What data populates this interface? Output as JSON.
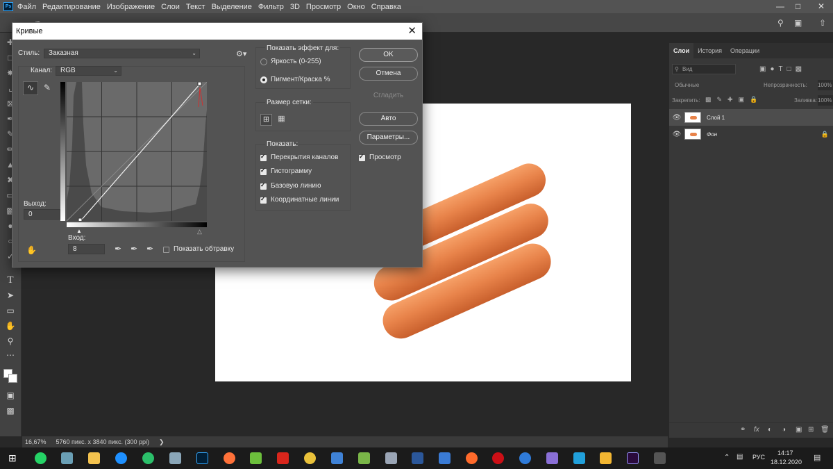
{
  "menubar": {
    "items": [
      "Файл",
      "Редактирование",
      "Изображение",
      "Слои",
      "Текст",
      "Выделение",
      "Фильтр",
      "3D",
      "Просмотр",
      "Окно",
      "Справка"
    ],
    "logo": "Ps"
  },
  "statusbar": {
    "zoom": "16,67%",
    "doc_info": "5760 пикс. x 3840 пикс. (300 ppi)"
  },
  "layers_panel": {
    "tabs": [
      "Слои",
      "История",
      "Операции"
    ],
    "search_placeholder": "Вид",
    "blend_mode": "Обычные",
    "opacity_label": "Непрозрачность:",
    "opacity_value": "100%",
    "lock_label": "Закрепить:",
    "fill_label": "Заливка:",
    "fill_value": "100%",
    "layers": [
      {
        "name": "Слой 1",
        "selected": true
      },
      {
        "name": "Фон",
        "locked": true
      }
    ]
  },
  "curves_dialog": {
    "title": "Кривые",
    "style_label": "Стиль:",
    "style_value": "Заказная",
    "channel_label": "Канал:",
    "channel_value": "RGB",
    "output_label": "Выход:",
    "output_value": "0",
    "input_label": "Вход:",
    "input_value": "8",
    "show_clipping_label": "Показать обтравку",
    "show_effect_title": "Показать эффект для:",
    "radio_brightness": "Яркость (0-255)",
    "radio_pigment": "Пигмент/Краска %",
    "grid_size_title": "Размер сетки:",
    "show_title": "Показать:",
    "show_options": [
      "Перекрытия каналов",
      "Гистограмму",
      "Базовую линию",
      "Координатные линии"
    ],
    "buttons": {
      "ok": "OK",
      "cancel": "Отмена",
      "smooth": "Сгладить",
      "auto": "Авто",
      "options": "Параметры..."
    },
    "preview_label": "Просмотр"
  },
  "taskbar": {
    "lang": "РУС",
    "time": "14:17",
    "date": "18.12.2020"
  },
  "icons": [
    "search-icon",
    "workspace-icon",
    "share-icon",
    "gear-icon",
    "curve-point-icon",
    "pencil-icon",
    "eyedropper-icon",
    "eye-icon",
    "lock-icon",
    "link-icon",
    "fx-icon",
    "mask-icon",
    "folder-icon",
    "new-layer-icon",
    "trash-icon"
  ],
  "colors": {
    "accent": "#31a8ff",
    "dialog_bg": "#535353",
    "panel_bg": "#383838",
    "sausage": "#e8834a"
  }
}
